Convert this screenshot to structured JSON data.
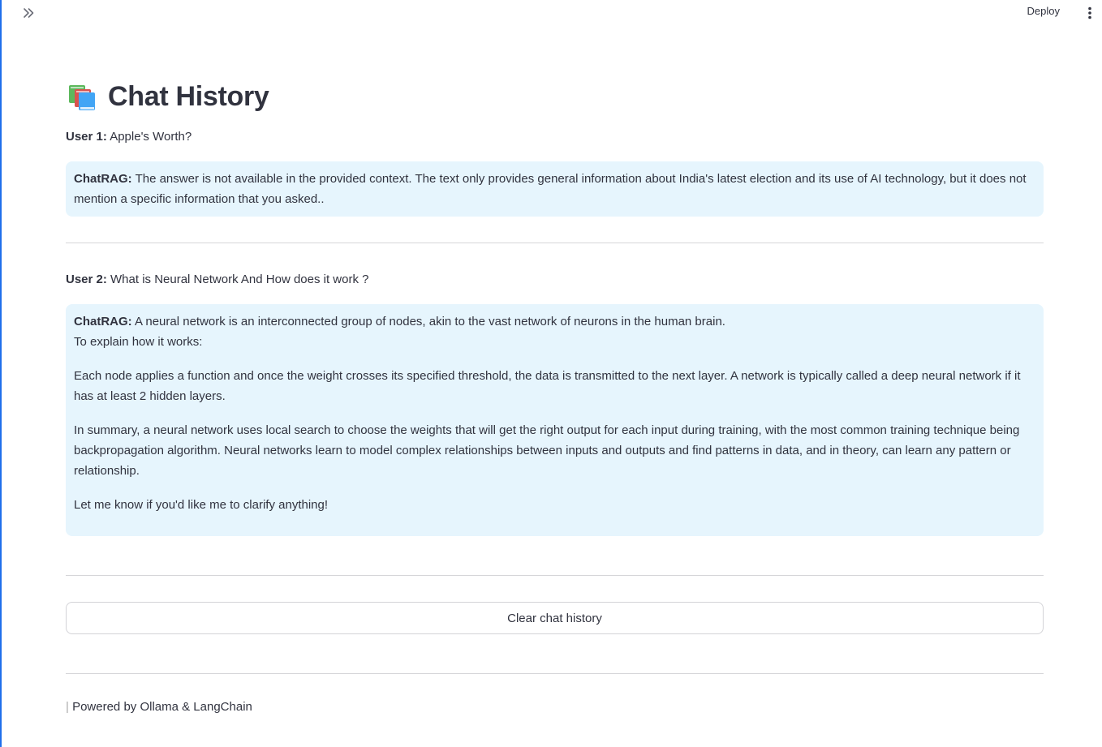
{
  "topbar": {
    "expand_icon": "double-chevron-right-icon",
    "deploy_label": "Deploy",
    "menu_icon": "vertical-dots-icon"
  },
  "page": {
    "title_icon": "books-icon",
    "title": "Chat History"
  },
  "conversation": [
    {
      "user_label": "User 1:",
      "user_text": " Apple's Worth?",
      "bot_label": "ChatRAG:",
      "bot_paragraphs": [
        " The answer is not available in the provided context. The text only provides general information about India's latest election and its use of AI technology, but it does not mention a specific information that you asked.."
      ]
    },
    {
      "user_label": "User 2:",
      "user_text": " What is Neural Network And How does it work ?",
      "bot_label": "ChatRAG:",
      "bot_first_line": " A neural network is an interconnected group of nodes, akin to the vast network of neurons in the human brain.",
      "bot_second_line": "To explain how it works:",
      "bot_paragraphs": [
        "Each node applies a function and once the weight crosses its specified threshold, the data is transmitted to the next layer. A network is typically called a deep neural network if it has at least 2 hidden layers.",
        "In summary, a neural network uses local search to choose the weights that will get the right output for each input during training, with the most common training technique being backpropagation algorithm. Neural networks learn to model complex relationships between inputs and outputs and find patterns in data, and in theory, can learn any pattern or relationship.",
        "Let me know if you'd like me to clarify anything!"
      ]
    }
  ],
  "actions": {
    "clear_label": "Clear chat history"
  },
  "footer": {
    "bar": "|",
    "text": " Powered by Ollama & LangChain"
  },
  "colors": {
    "bot_bg": "#e6f5fd",
    "text": "#31333f",
    "divider": "#d6d6d9"
  }
}
